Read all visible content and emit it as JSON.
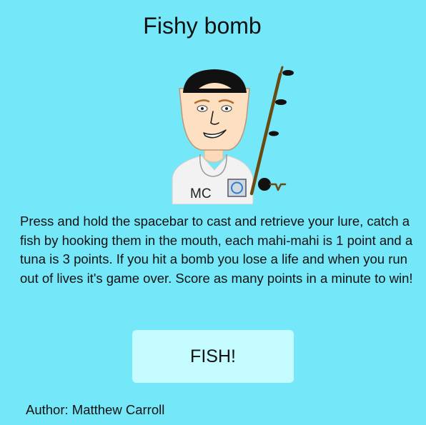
{
  "title": "Fishy bomb",
  "portrait": {
    "shirt_initials": "MC"
  },
  "instructions": "Press and hold the spacebar to cast and retrieve your lure, catch a fish by hooking them in the mouth, each mahi-mahi is 1 point and a tuna is 3 points. If you hit a bomb you lose a life and when you run out of lives it's game over. Score as many points in a minute to win!",
  "fish_button": {
    "label": "FISH!"
  },
  "author": "Author: Matthew Carroll",
  "colors": {
    "background": "#74e8f8",
    "button": "#c4fbff",
    "skin": "#fde0c2",
    "cap": "#111111",
    "rod": "#6b4a12"
  }
}
